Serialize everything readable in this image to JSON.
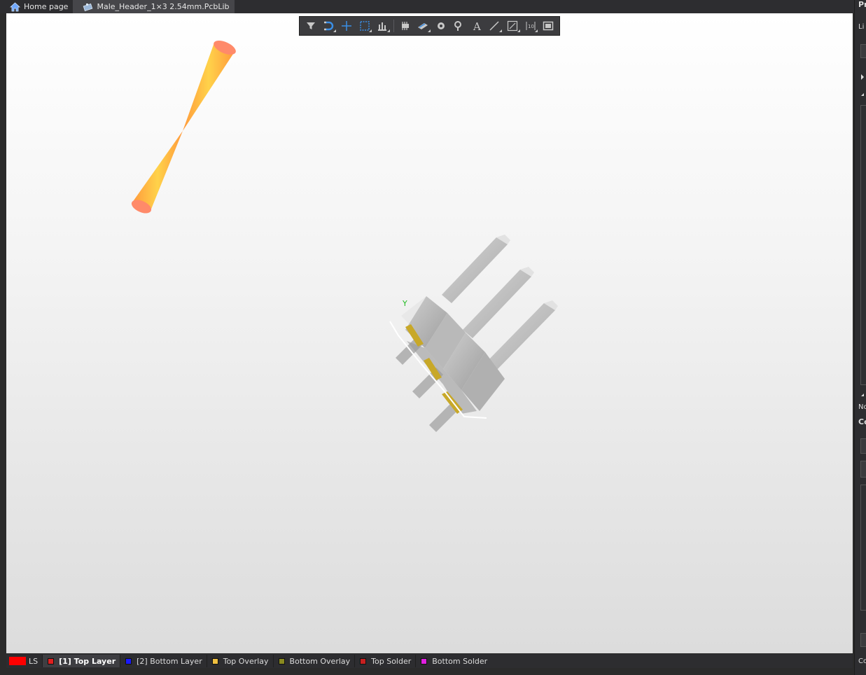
{
  "tabs": [
    {
      "label": "Home page",
      "icon": "home-icon",
      "active": false
    },
    {
      "label": "Male_Header_1×3 2.54mm.PcbLib",
      "icon": "pcblib-icon",
      "active": true
    }
  ],
  "toolbar": {
    "buttons": [
      {
        "name": "filter-icon",
        "menu": false
      },
      {
        "name": "snap-magnet-icon",
        "menu": true
      },
      {
        "name": "crosshair-icon",
        "menu": false
      },
      {
        "name": "select-rect-icon",
        "menu": true
      },
      {
        "name": "align-icon",
        "menu": true
      },
      {
        "name": "component-icon",
        "menu": false
      },
      {
        "name": "place-body-icon",
        "menu": true
      },
      {
        "name": "pad-icon",
        "menu": false
      },
      {
        "name": "via-icon",
        "menu": false
      },
      {
        "name": "text-icon",
        "menu": false
      },
      {
        "name": "line-icon",
        "menu": true
      },
      {
        "name": "dimension-icon",
        "menu": true
      },
      {
        "name": "designator-icon",
        "menu": true
      },
      {
        "name": "region-icon",
        "menu": false
      }
    ]
  },
  "right_panel": {
    "labels": [
      "Pr",
      "Li",
      "No",
      "Co",
      "Co"
    ]
  },
  "layer_bar": {
    "ls_label": "LS",
    "ls_color": "#ff0000",
    "layers": [
      {
        "label": "[1] Top Layer",
        "color": "#e02020",
        "active": true
      },
      {
        "label": "[2] Bottom Layer",
        "color": "#1a1aff",
        "active": false
      },
      {
        "label": "Top Overlay",
        "color": "#f0c040",
        "active": false
      },
      {
        "label": "Bottom Overlay",
        "color": "#8a8a20",
        "active": false
      },
      {
        "label": "Top Solder",
        "color": "#c82020",
        "active": false
      },
      {
        "label": "Bottom Solder",
        "color": "#e020e0",
        "active": false
      }
    ]
  },
  "scene": {
    "axis_label": "Y"
  },
  "colors": {
    "accent": "#3a8ee6",
    "pin_gray": "#c4c4c4",
    "pad_gold": "#c8a828",
    "cone_orange": "#ffa040"
  }
}
